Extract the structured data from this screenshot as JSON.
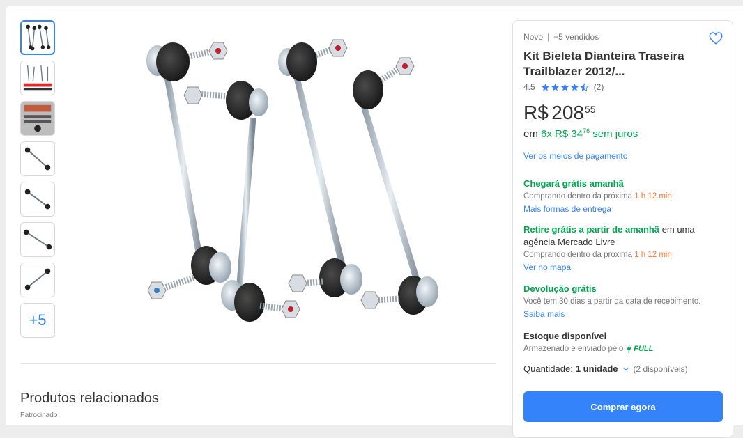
{
  "gallery": {
    "more_label": "+5"
  },
  "related": {
    "title": "Produtos relacionados",
    "sponsored": "Patrocinado"
  },
  "product": {
    "condition": "Novo",
    "sold": "+5 vendidos",
    "title": "Kit Bieleta Dianteira Traseira Trailblazer 2012/...",
    "rating": "4.5",
    "rating_stars": 4.5,
    "review_count": "(2)",
    "price_currency": "R$",
    "price_integer": "208",
    "price_cents": "55",
    "installments_prefix": "em",
    "installments_main": "6x R$ 34",
    "installments_cents": "76",
    "installments_suffix": "sem juros",
    "payment_link": "Ver os meios de pagamento"
  },
  "shipping": {
    "delivery_head": "Chegará grátis amanhã",
    "delivery_desc": "Comprando dentro da próxima",
    "delivery_time": "1 h 12 min",
    "delivery_link": "Mais formas de entrega",
    "pickup_head": "Retire grátis a partir de amanhã",
    "pickup_head_rest": "em uma agência Mercado Livre",
    "pickup_desc": "Comprando dentro da próxima",
    "pickup_time": "1 h 12 min",
    "pickup_link": "Ver no mapa",
    "return_head": "Devolução grátis",
    "return_desc": "Você tem 30 dias a partir da data de recebimento.",
    "return_link": "Saiba mais"
  },
  "stock": {
    "title": "Estoque disponível",
    "stored_text": "Armazenado e enviado pelo",
    "full_label": "FULL",
    "quantity_label": "Quantidade:",
    "quantity_value": "1 unidade",
    "available": "(2 disponíveis)"
  },
  "actions": {
    "buy_now": "Comprar agora"
  },
  "colors": {
    "accent_blue": "#3483fa",
    "green": "#00a650",
    "orange": "#ff7733"
  }
}
